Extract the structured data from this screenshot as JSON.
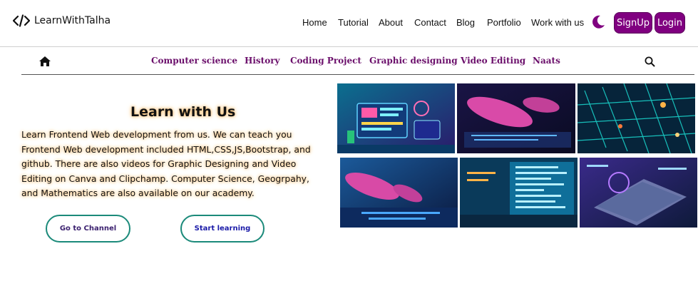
{
  "brand": {
    "name": "LearnWithTalha",
    "icon": "code-brackets-icon"
  },
  "nav": {
    "items": [
      "Home",
      "Tutorial",
      "About",
      "Contact",
      "Blog",
      "Portfolio",
      "Work with us"
    ],
    "theme_icon": "moon-icon",
    "signup_label": "SignUp",
    "login_label": "Login"
  },
  "categories": {
    "home_icon": "home-icon",
    "items": [
      "Computer science",
      "History",
      "Coding Project",
      "Graphic designing",
      "Video Editing",
      "Naats"
    ],
    "search_icon": "search-icon"
  },
  "hero": {
    "title": "Learn with Us",
    "text": "Learn Frontend Web development from us. We can teach you Frontend Web development included HTML,CSS,JS,Bootstrap, and github. There are also videos for Graphic Designing and Video Editing on Canva and Clipchamp. Computer Science, Geogrpahy, and Mathematics are also available on our academy.",
    "channel_button": "Go to Channel",
    "start_button": "Start learning"
  },
  "gallery": {
    "images": [
      "web-dev-illustration",
      "hands-typing-keyboard",
      "digital-data-matrix",
      "hands-typing-keyboard-2",
      "code-screen-display",
      "laptop-futuristic-code"
    ]
  },
  "colors": {
    "accent": "#800080",
    "category_text": "#6b0f6b",
    "cta_border": "#1b8a7a",
    "text_glow": "#f7b45a"
  }
}
